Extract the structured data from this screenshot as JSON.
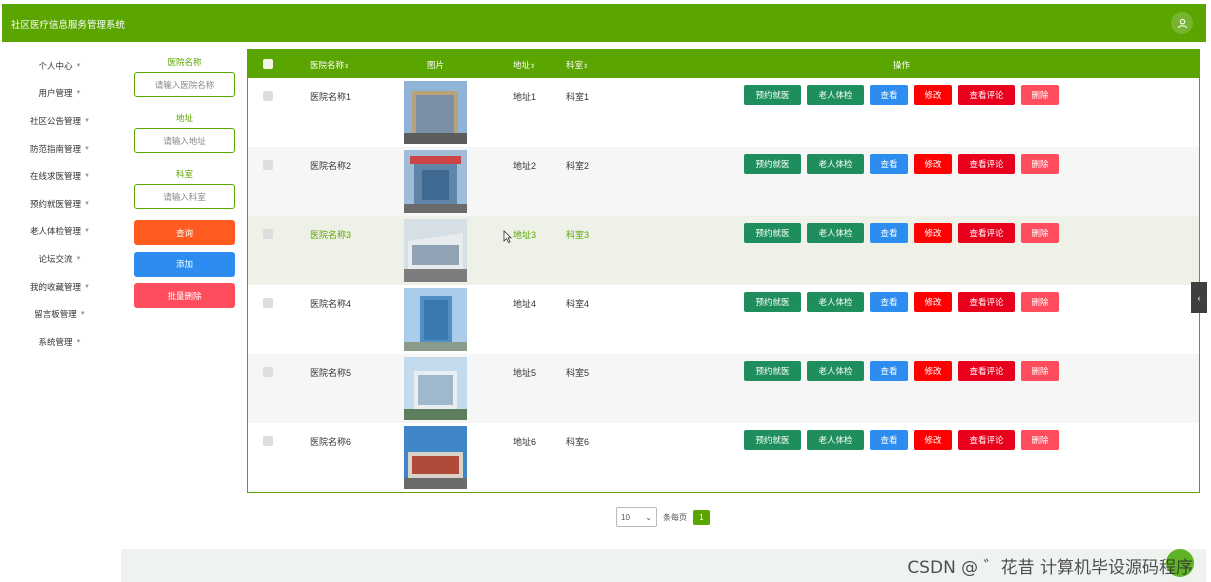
{
  "app": {
    "title": "社区医疗信息服务管理系统"
  },
  "sidebar": {
    "items": [
      {
        "label": "个人中心"
      },
      {
        "label": "用户管理"
      },
      {
        "label": "社区公告管理"
      },
      {
        "label": "防范指南管理"
      },
      {
        "label": "在线求医管理"
      },
      {
        "label": "预约就医管理"
      },
      {
        "label": "老人体检管理"
      },
      {
        "label": "论坛交流"
      },
      {
        "label": "我的收藏管理"
      },
      {
        "label": "留言板管理"
      },
      {
        "label": "系统管理"
      }
    ]
  },
  "filters": {
    "hospital_label": "医院名称",
    "hospital_placeholder": "请输入医院名称",
    "address_label": "地址",
    "address_placeholder": "请输入地址",
    "dept_label": "科室",
    "dept_placeholder": "请输入科室",
    "query_btn": "查询",
    "add_btn": "添加",
    "batch_delete_btn": "批量删除",
    "colors": {
      "query": "#ff5a1f",
      "add": "#2d8cf0",
      "batch_delete": "#ff4d5e"
    }
  },
  "table": {
    "headers": {
      "name": "医院名称",
      "image": "图片",
      "address": "地址",
      "dept": "科室",
      "ops": "操作"
    },
    "ops": {
      "book": "预约就医",
      "check": "老人体检",
      "view": "查看",
      "edit": "修改",
      "reviews": "查看评论",
      "delete": "删除"
    },
    "rows": [
      {
        "name": "医院名称1",
        "address": "地址1",
        "dept": "科室1"
      },
      {
        "name": "医院名称2",
        "address": "地址2",
        "dept": "科室2"
      },
      {
        "name": "医院名称3",
        "address": "地址3",
        "dept": "科室3"
      },
      {
        "name": "医院名称4",
        "address": "地址4",
        "dept": "科室4"
      },
      {
        "name": "医院名称5",
        "address": "地址5",
        "dept": "科室5"
      },
      {
        "name": "医院名称6",
        "address": "地址6",
        "dept": "科室6"
      }
    ]
  },
  "pager": {
    "page_size": "10",
    "per_page_label": "条每页",
    "current_page": "1"
  },
  "watermark": "CSDN @ ゛花昔 计算机毕设源码程序",
  "theme": {
    "primary": "#5aa500"
  }
}
